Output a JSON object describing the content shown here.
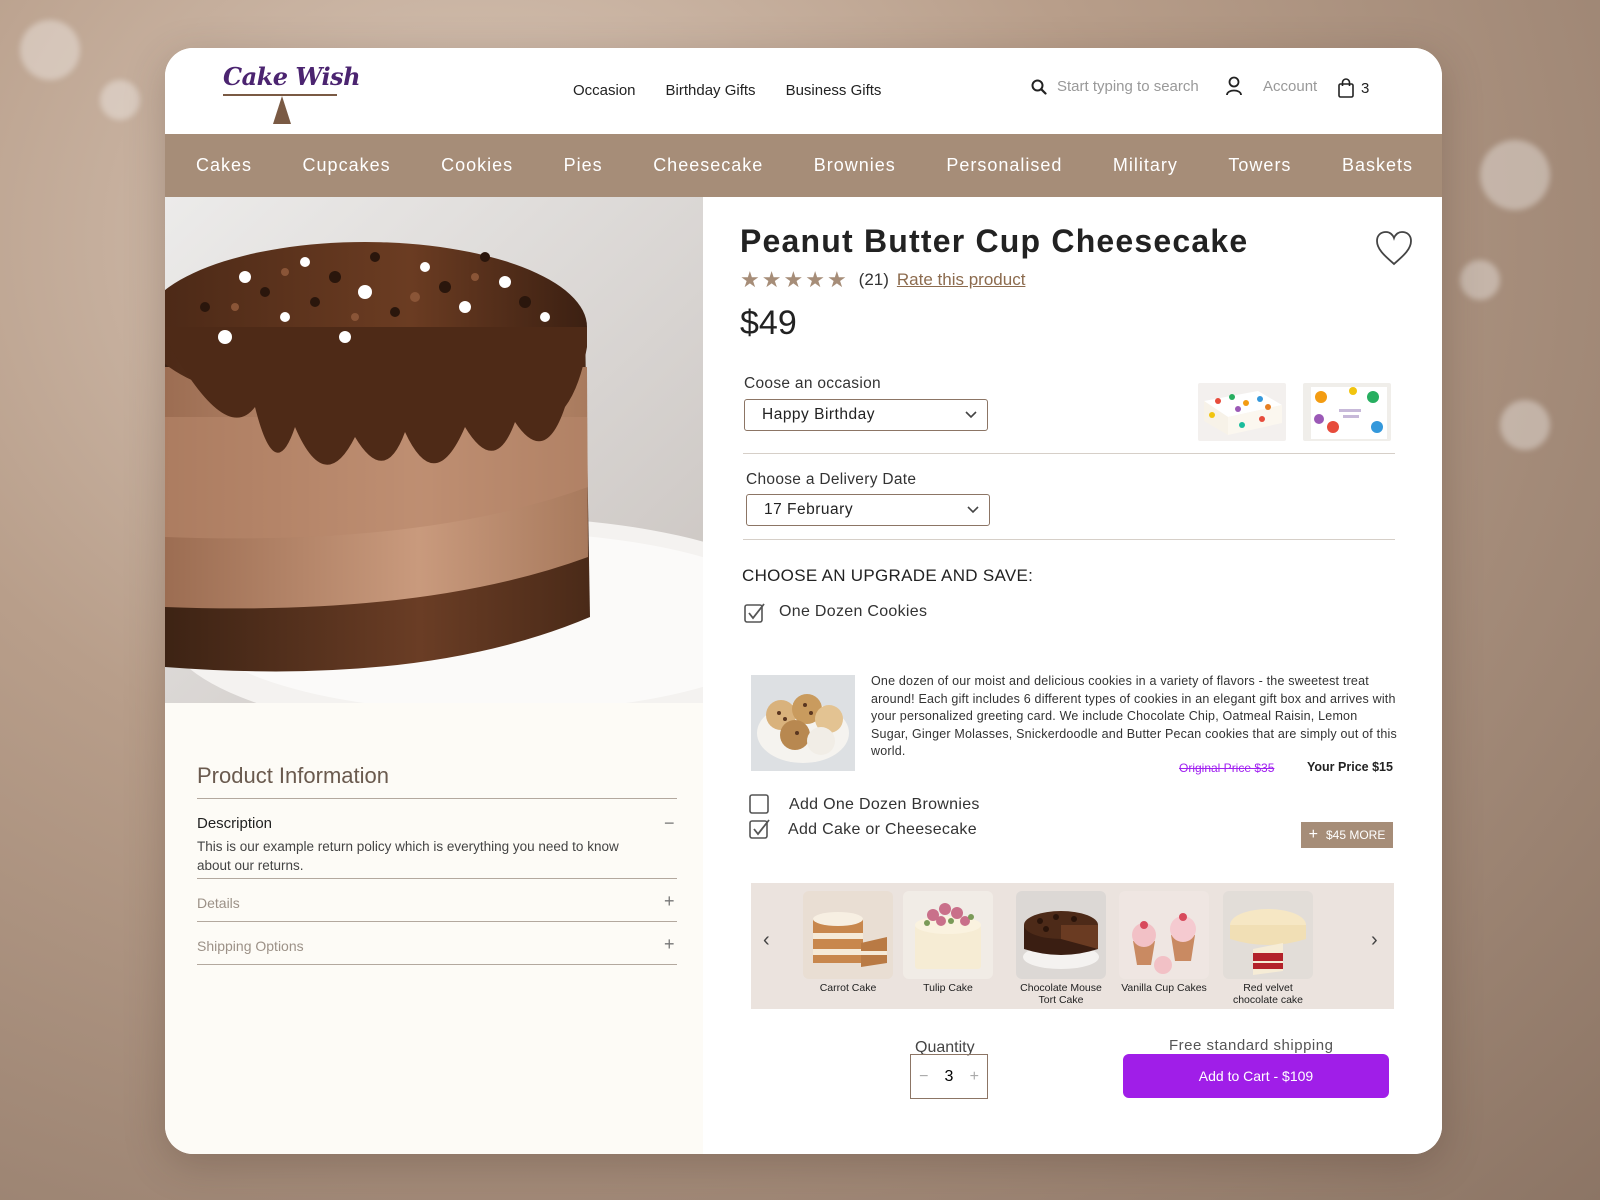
{
  "header": {
    "logo_text": "Cake Wish",
    "nav": [
      "Occasion",
      "Birthday Gifts",
      "Business Gifts"
    ],
    "search_placeholder": "Start typing to search",
    "account_label": "Account",
    "cart_count": "3"
  },
  "categories": [
    "Cakes",
    "Cupcakes",
    "Cookies",
    "Pies",
    "Cheesecake",
    "Brownies",
    "Personalised",
    "Military",
    "Towers",
    "Baskets"
  ],
  "product": {
    "title": "Peanut Butter Cup Cheesecake",
    "rating_stars": 5,
    "review_count": "(21)",
    "rate_link": "Rate this product",
    "price": "$49"
  },
  "occasion": {
    "label": "Coose an occasion",
    "value": "Happy Birthday"
  },
  "delivery": {
    "label": "Choose a Delivery Date",
    "value": "17 February"
  },
  "upgrade": {
    "title": "CHOOSE AN UPGRADE AND SAVE:",
    "cookies_label": "One Dozen Cookies",
    "cookies_description": "One dozen of our moist and delicious cookies in a variety of flavors - the sweetest treat around! Each gift includes 6 different types of cookies in an elegant gift box and arrives with your personalized greeting card. We include Chocolate Chip, Oatmeal Raisin, Lemon Sugar, Ginger Molasses, Snickerdoodle and Butter Pecan cookies that are simply out of this world.",
    "original_price": "Original Price $35",
    "your_price": "Your Price $15",
    "brownies_label": "Add One Dozen Brownies",
    "cake_label": "Add Cake or Cheesecake",
    "more_button": "$45 MORE",
    "checks": {
      "cookies": true,
      "brownies": false,
      "cake": true
    }
  },
  "carousel": [
    {
      "label": "Carrot Cake"
    },
    {
      "label": "Tulip Cake"
    },
    {
      "label": "Chocolate Mouse Tort Cake"
    },
    {
      "label": "Vanilla Cup Cakes"
    },
    {
      "label": "Red velvet chocolate cake"
    }
  ],
  "purchase": {
    "quantity_label": "Quantity",
    "quantity": "3",
    "minus": "−",
    "plus": "+",
    "shipping": "Free standard shipping",
    "cart_button": "Add to Cart - $109"
  },
  "info": {
    "title": "Product Information",
    "description_title": "Description",
    "description_body": "This is our example return policy which is everything you need to know about our returns.",
    "details_title": "Details",
    "shipping_title": "Shipping Options"
  },
  "colors": {
    "accent": "#a68d78",
    "cta": "#a01ee8",
    "logo": "#4b2470"
  },
  "icons": [
    "search-icon",
    "user-icon",
    "bag-icon",
    "heart-icon",
    "star-icon",
    "chevron-down-icon",
    "checkbox-icon",
    "plus-icon",
    "minus-icon",
    "chevron-left-icon",
    "chevron-right-icon"
  ]
}
